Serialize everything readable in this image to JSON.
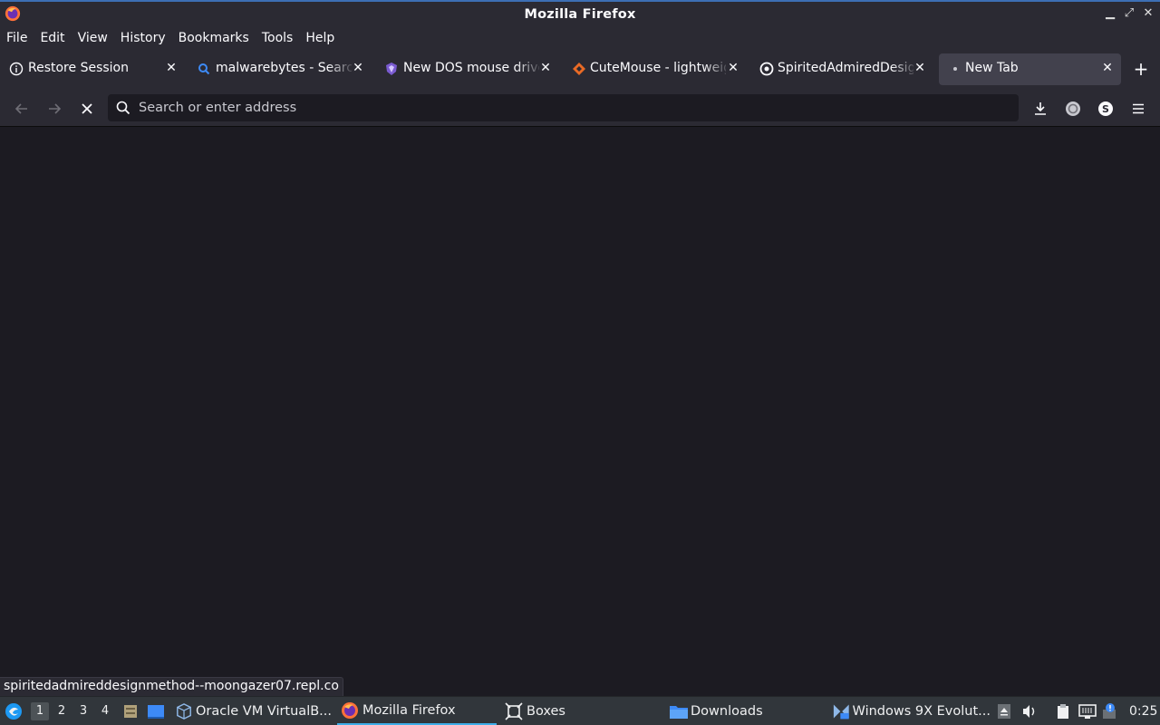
{
  "window": {
    "title": "Mozilla Firefox"
  },
  "menubar": {
    "items": [
      {
        "label": "File"
      },
      {
        "label": "Edit"
      },
      {
        "label": "View"
      },
      {
        "label": "History"
      },
      {
        "label": "Bookmarks"
      },
      {
        "label": "Tools"
      },
      {
        "label": "Help"
      }
    ]
  },
  "tabs": [
    {
      "label": "Restore Session",
      "icon": "info-icon"
    },
    {
      "label": "malwarebytes - Search",
      "icon": "search-icon"
    },
    {
      "label": "New DOS mouse driver",
      "icon": "shield-icon"
    },
    {
      "label": "CuteMouse - lightweight",
      "icon": "diamond-icon"
    },
    {
      "label": "SpiritedAdmiredDesign",
      "icon": "replit-icon"
    },
    {
      "label": "New Tab",
      "icon": "loading-icon",
      "active": true
    }
  ],
  "urlbar": {
    "placeholder": "Search or enter address",
    "value": ""
  },
  "statusbar": {
    "text": "spiritedadmireddesignmethod--moongazer07.repl.co"
  },
  "taskbar": {
    "workspaces": [
      "1",
      "2",
      "3",
      "4"
    ],
    "current_workspace": "1",
    "tasks": [
      {
        "label": "Oracle VM VirtualB...",
        "icon": "virtualbox-icon"
      },
      {
        "label": "Mozilla Firefox",
        "icon": "firefox-icon",
        "active": true
      },
      {
        "label": "Boxes",
        "icon": "boxes-icon"
      },
      {
        "label": "Downloads",
        "icon": "folder-icon"
      },
      {
        "label": "Windows 9X Evolut...",
        "icon": "vm-window-icon"
      }
    ],
    "clock": "0:25"
  },
  "colors": {
    "accent": "#3daee9",
    "toolbar": "#2b2a33",
    "content": "#1c1b22"
  }
}
